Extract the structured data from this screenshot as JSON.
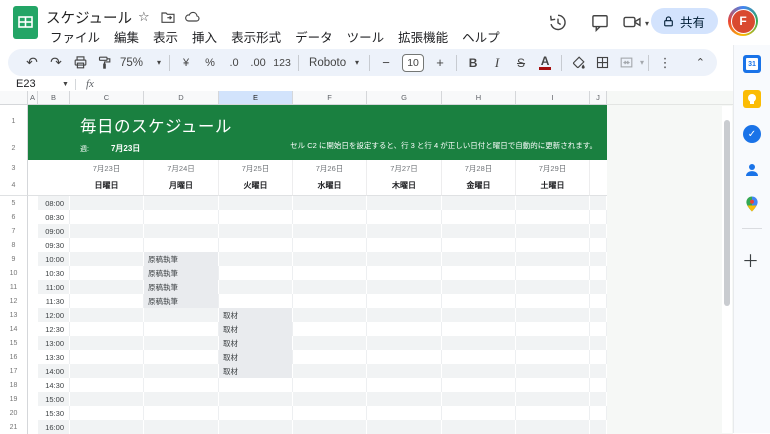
{
  "titlebar": {
    "doc_title": "スケジュール",
    "menu_items": [
      "ファイル",
      "編集",
      "表示",
      "挿入",
      "表示形式",
      "データ",
      "ツール",
      "拡張機能",
      "ヘルプ"
    ],
    "share_label": "共有",
    "avatar_letter": "F"
  },
  "toolbar": {
    "zoom_value": "75%",
    "currency_label": "¥",
    "percent_label": "%",
    "decrease_decimal_label": ".0",
    "increase_decimal_label": ".00",
    "format_123_label": "123",
    "font_family_value": "Roboto",
    "font_size_decrease": "−",
    "font_size_value": "10",
    "font_size_increase": "+",
    "bold_label": "B",
    "italic_label": "I",
    "strikethrough_label": "S",
    "text_color_label": "A",
    "more_label": "⋮",
    "collapse_label": "⌃"
  },
  "formula_bar": {
    "cell_reference": "E23",
    "fx_label": "fx"
  },
  "sheet": {
    "column_headers": [
      "A",
      "B",
      "C",
      "D",
      "E",
      "F",
      "G",
      "H",
      "I",
      "J"
    ],
    "highlighted_column": "E",
    "banner": {
      "title": "毎日のスケジュール",
      "week_label": "週:",
      "week_start": "7月23日",
      "note": "セル C2 に開始日を設定すると、行 3 と行 4 が正しい日付と曜日で自動的に更新されます。"
    },
    "days": [
      {
        "date": "7月23日",
        "weekday": "日曜日"
      },
      {
        "date": "7月24日",
        "weekday": "月曜日"
      },
      {
        "date": "7月25日",
        "weekday": "火曜日"
      },
      {
        "date": "7月26日",
        "weekday": "水曜日"
      },
      {
        "date": "7月27日",
        "weekday": "木曜日"
      },
      {
        "date": "7月28日",
        "weekday": "金曜日"
      },
      {
        "date": "7月29日",
        "weekday": "土曜日"
      }
    ],
    "times": [
      "08:00",
      "08:30",
      "09:00",
      "09:30",
      "10:00",
      "10:30",
      "11:00",
      "11:30",
      "12:00",
      "12:30",
      "13:00",
      "13:30",
      "14:00",
      "14:30",
      "15:00",
      "15:30",
      "16:00"
    ],
    "first_data_row_number": 5,
    "events": [
      {
        "label": "原稿執筆",
        "day_index": 1,
        "times": [
          "10:00",
          "10:30",
          "11:00",
          "11:30"
        ]
      },
      {
        "label": "取材",
        "day_index": 2,
        "times": [
          "12:00",
          "12:30",
          "13:00",
          "13:30",
          "14:00"
        ]
      }
    ]
  },
  "side_panel": {
    "calendar_label": "31"
  },
  "colors": {
    "banner_green": "#1a8040",
    "share_button_bg": "#d3e3fd",
    "avatar_red": "#d9492f",
    "selected_column_bg": "#d2e3fc",
    "logo_green": "#23a566"
  }
}
